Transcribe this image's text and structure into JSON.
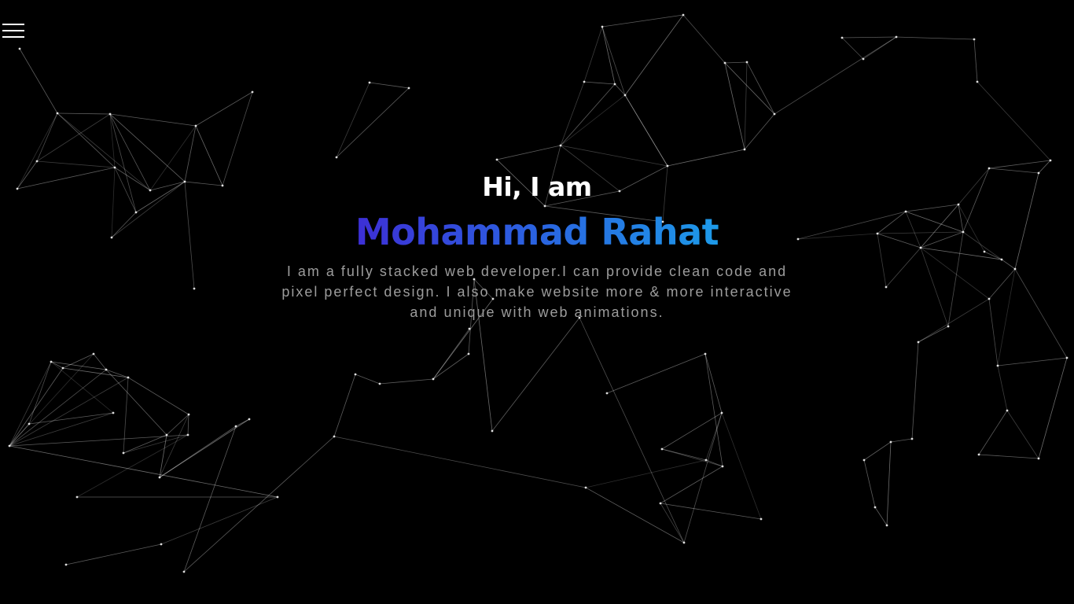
{
  "header": {
    "menu_icon": "hamburger-menu-icon"
  },
  "hero": {
    "greeting": "Hi, I am",
    "name": "Mohammad Rahat",
    "bio": "I am a fully stacked web developer.I can provide clean code and pixel perfect design. I also make website more & more interactive and unique with web animations."
  },
  "colors": {
    "background": "#000000",
    "name_gradient_start": "#3d2fd6",
    "name_gradient_end": "#1d9ae8",
    "bio_text": "#9c9c9c",
    "network_lines": "#ffffff"
  }
}
